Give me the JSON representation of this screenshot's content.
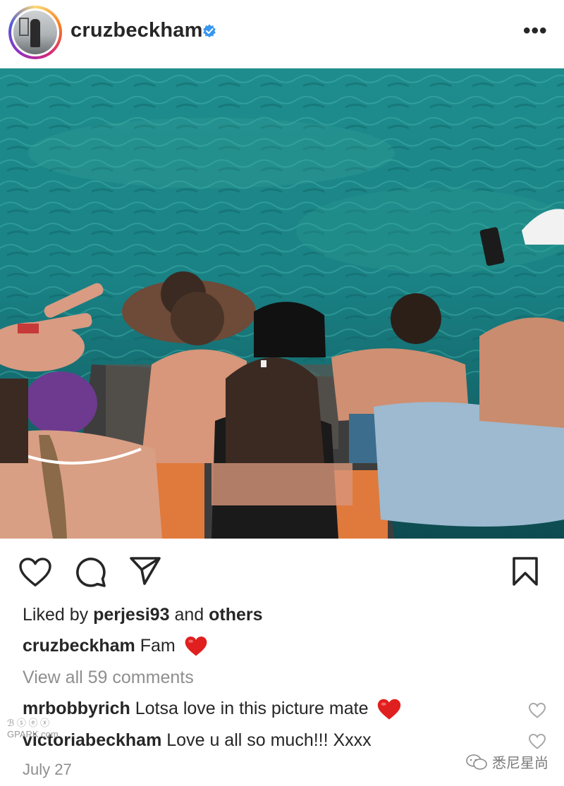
{
  "post": {
    "username": "cruzbeckham",
    "liked_by_prefix": "Liked by",
    "liked_by_user": "perjesi93",
    "liked_by_and": "and",
    "liked_by_others": "others",
    "caption_user": "cruzbeckham",
    "caption_text": "Fam",
    "view_all_comments": "View all 59 comments",
    "date": "July 27"
  },
  "comments": [
    {
      "user": "mrbobbyrich",
      "text": "Lotsa love in this picture mate"
    },
    {
      "user": "victoriabeckham",
      "text": "Love u all so much!!! Xxxx"
    }
  ],
  "watermark": {
    "line1": "ℬ ⓢ ⓔ ⓧ",
    "line2": "GPARK.com",
    "wechat_label": "悉尼星尚"
  },
  "icons": {
    "verified": "verified-badge-icon",
    "more": "more-options-icon",
    "like": "heart-icon",
    "comment": "comment-bubble-icon",
    "share": "paper-plane-icon",
    "save": "bookmark-icon"
  },
  "colors": {
    "verified": "#3897f0",
    "heart_emoji": "#e0201f",
    "muted_text": "#8e8e8e"
  }
}
